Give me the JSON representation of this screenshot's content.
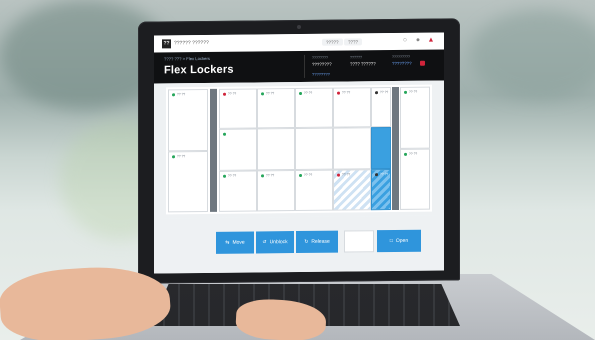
{
  "topbar": {
    "logo_mark": "??",
    "logo_text": "?????? ??????",
    "tabs": [
      "?????",
      "????"
    ],
    "icons": [
      "help-icon",
      "user-icon",
      "alert-icon"
    ]
  },
  "header": {
    "breadcrumb": "???? ??? > Flex Lockers",
    "title": "Flex Lockers",
    "fields": [
      {
        "label": "????????",
        "value": "????????"
      },
      {
        "label": "??????",
        "value": "???? ??????"
      },
      {
        "label": "?????????",
        "value": "????????"
      }
    ],
    "link": "????????"
  },
  "lockers": [
    {
      "label": "?? ??",
      "status": "green"
    },
    {
      "label": "?? ??",
      "status": "red"
    },
    {
      "label": "?? ??",
      "status": "green"
    },
    {
      "label": "?? ??",
      "status": "green"
    },
    {
      "label": "?? ??",
      "status": "red"
    },
    {
      "label": "?? ??",
      "status": "dark"
    },
    {
      "label": "?? ??",
      "status": "green"
    },
    {
      "label": "?? ??",
      "status": "green"
    },
    {
      "label": "?? ??",
      "status": "green"
    },
    {
      "label": "?? ??",
      "status": "green"
    },
    {
      "label": "?? ??",
      "status": "red"
    },
    {
      "label": "?? ??",
      "status": "dark"
    },
    {
      "label": "?? ??",
      "status": "green"
    },
    {
      "label": "?? ??",
      "status": "green"
    }
  ],
  "actions": {
    "move": "Move",
    "unblock": "Unblock",
    "release": "Release",
    "open": "Open"
  },
  "colors": {
    "accent": "#2f95dc",
    "selected": "#3aa0e0",
    "header_bg": "#0f1012",
    "alert": "#d0243b"
  }
}
